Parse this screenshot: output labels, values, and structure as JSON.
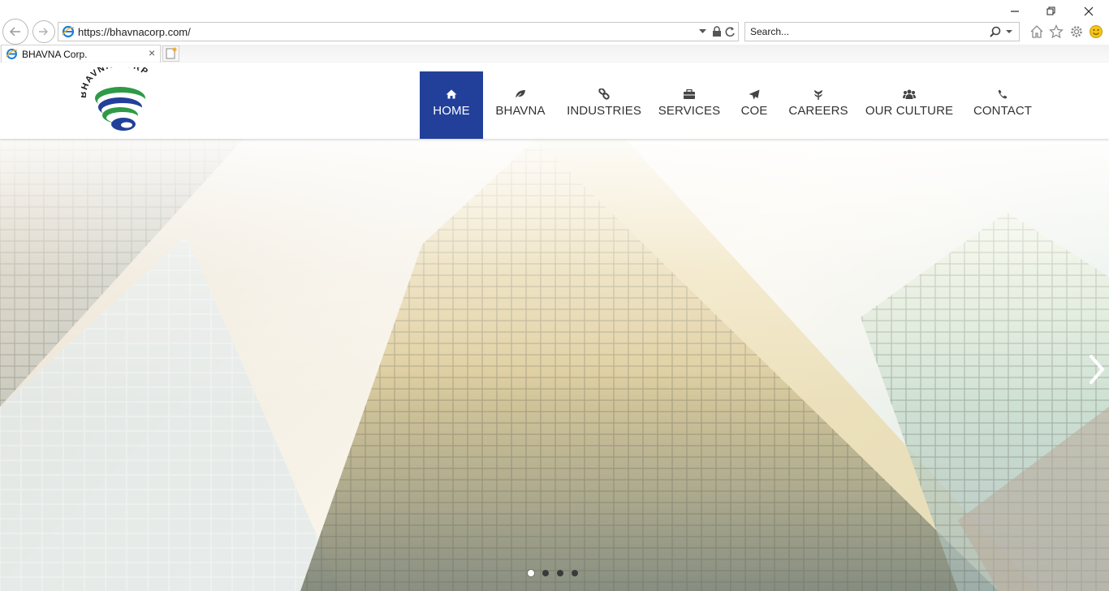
{
  "browser": {
    "url": "https://bhavnacorp.com/",
    "search_placeholder": "Search...",
    "tab_title": "BHAVNA Corp.",
    "window_buttons": [
      "minimize-icon",
      "restore-icon",
      "close-icon"
    ],
    "toolbar_icons": [
      "home-icon",
      "favorites-star-icon",
      "settings-gear-icon",
      "feedback-smiley-icon"
    ]
  },
  "site": {
    "logo_text": "BHAVNA CORP",
    "nav": [
      {
        "label": "HOME",
        "icon": "home-icon",
        "active": true
      },
      {
        "label": "BHAVNA",
        "icon": "leaf-icon"
      },
      {
        "label": "INDUSTRIES",
        "icon": "link-icon"
      },
      {
        "label": "SERVICES",
        "icon": "briefcase-icon"
      },
      {
        "label": "COE",
        "icon": "paper-plane-icon"
      },
      {
        "label": "CAREERS",
        "icon": "plant-icon"
      },
      {
        "label": "OUR CULTURE",
        "icon": "users-icon"
      },
      {
        "label": "CONTACT",
        "icon": "phone-icon"
      }
    ],
    "colors": {
      "brand_blue": "#22409a",
      "brand_green": "#2e9a47"
    }
  },
  "hero": {
    "slides_total": 4,
    "active_slide": 1
  }
}
